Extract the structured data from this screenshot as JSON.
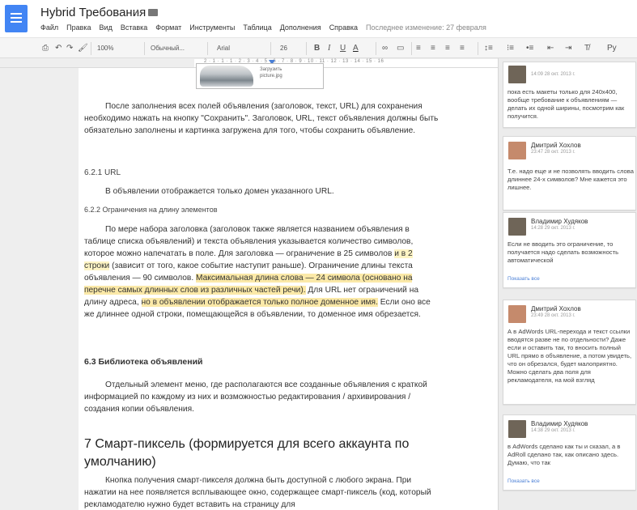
{
  "header": {
    "title": "Hybrid Требования",
    "menu": [
      "Файл",
      "Правка",
      "Вид",
      "Вставка",
      "Формат",
      "Инструменты",
      "Таблица",
      "Дополнения",
      "Справка"
    ],
    "last_edit": "Последнее изменение: 27 февраля"
  },
  "toolbar": {
    "zoom": "100%",
    "style": "Обычный...",
    "font": "Arial",
    "size": "26",
    "bold": "B",
    "italic": "I",
    "underline": "U",
    "text_color": "A",
    "extra": "Py"
  },
  "ruler": {
    "numbers": "2 · 1 · 1 · 1 · 2 · 3 · 4 · 5 · 6 · 7 · 8 · 9 · 10 · 11 · 12 · 13 · 14 · 15 · 16"
  },
  "image": {
    "caption_1": "Загрузить",
    "caption_2": "picture.jpg"
  },
  "doc": {
    "p1": "После заполнения всех полей объявления (заголовок, текст, URL) для сохранения необходимо нажать на кнопку \"Сохранить\". Заголовок, URL, текст объявления должны быть обязательно заполнены и картинка загружена для того, чтобы сохранить объявление.",
    "h621": "6.2.1 URL",
    "p2": "В объявлении отображается только домен указанного URL.",
    "h622": "6.2.2 Ограничения на длину элементов",
    "p3a": "По мере набора заголовка (заголовок также является названием объявления в таблице списка объявлений) и текста объявления указывается количество символов, которое можно напечатать в поле. Для заголовка — ограничение в 25 символов ",
    "p3b": "и в 2 строки",
    "p3c": " (зависит от того, какое событие наступит раньше). Ограничение длины текста объявления — 90 символов. ",
    "p3d": "Максимальная длина слова — 24 символа (основано на перечне самых длинных слов из различных частей речи).",
    "p3e": " Для URL нет ограничений на длину адреса, ",
    "p3f": "но в объявлении отображается только полное доменное имя.",
    "p3g": " Если оно все же длиннее одной строки, помещающейся в объявлении, то доменное имя обрезается.",
    "h63": "6.3 Библиотека объявлений",
    "p4": "Отдельный элемент меню, где располагаются все созданные объявления с краткой информацией по каждому из них и возможностью редактирования / архивирования / создания копии объявления.",
    "h7": "7 Смарт-пиксель (формируется для всего аккаунта по умолчанию)",
    "p5": "Кнопка получения смарт-пикселя должна быть доступной с любого экрана. При нажатии на нее появляется всплывающее окно, содержащее смарт-пиксель (код, который рекламодателю нужно будет вставить на страницу для"
  },
  "comments": [
    {
      "name": "",
      "date": "14:09 28 окт. 2013 г.",
      "text": "пока есть макеты только для 240х400, вообще требование к объявлениям — делать их одной ширины, посмотрим как получится."
    },
    {
      "name": "Дмитрий Хохлов",
      "date": "23:47 28 окт. 2013 г.",
      "text": "Т.е. надо еще и не позволять вводить слова длиннее 24-х символов? Мне кажется это лишнее."
    },
    {
      "name": "Владимир Худяков",
      "date": "14:28 29 окт. 2013 г.",
      "text": "Если не вводить это ограничение, то получается надо сделать возможность автоматической",
      "show_all": "Показать все"
    },
    {
      "name": "Дмитрий Хохлов",
      "date": "23:49 28 окт. 2013 г.",
      "text": "А в AdWords URL-перехода и текст ссылки вводятся разве не по отдельности? Даже если и оставить так, то вносить полный URL прямо в объявление, а потом увидеть, что он обрезался, будет малоприятно. Можно сделать два поля для рекламодателя, на мой взгляд"
    },
    {
      "name": "Владимир Худяков",
      "date": "14:38 29 окт. 2013 г.",
      "text": "в AdWords сделано как ты и сказал, а в AdRoll сделано так, как описано здесь. Думаю, что так",
      "show_all": "Показать все"
    }
  ]
}
